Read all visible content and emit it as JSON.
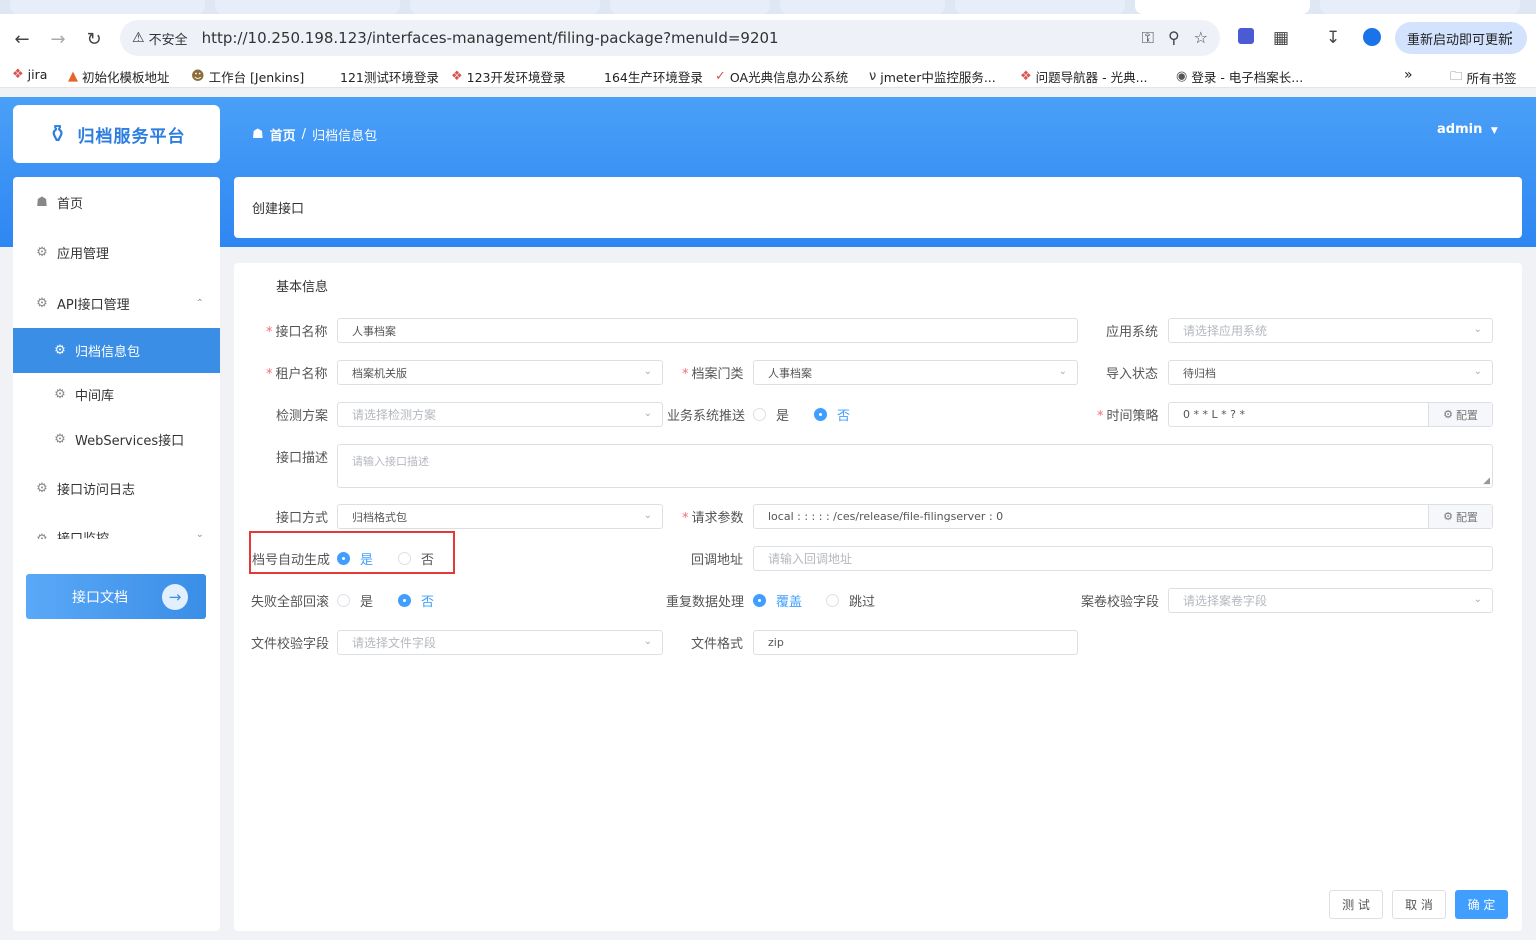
{
  "browser": {
    "security_label": "不安全",
    "url": "http://10.250.198.123/interfaces-management/filing-package?menuId=9201",
    "update_button": "重新启动即可更新",
    "bookmarks": [
      {
        "label": "jira"
      },
      {
        "label": "初始化模板地址"
      },
      {
        "label": "工作台 [Jenkins]"
      },
      {
        "label": "121测试环境登录"
      },
      {
        "label": "123开发环境登录"
      },
      {
        "label": "164生产环境登录"
      },
      {
        "label": "OA光典信息办公系统"
      },
      {
        "label": "jmeter中监控服务..."
      },
      {
        "label": "问题导航器 - 光典..."
      },
      {
        "label": "登录 - 电子档案长..."
      }
    ],
    "bookmarks_more": "»",
    "all_bookmarks": "所有书签"
  },
  "app": {
    "logo_text": "归档服务平台",
    "breadcrumb": {
      "home": "首页",
      "separator": "/",
      "current": "归档信息包"
    },
    "user": "admin"
  },
  "sidebar": {
    "items": [
      {
        "label": "首页",
        "icon": "home-icon"
      },
      {
        "label": "应用管理",
        "icon": "gear-icon"
      },
      {
        "label": "API接口管理",
        "icon": "gear-icon"
      },
      {
        "label": "归档信息包",
        "icon": "gear-icon"
      },
      {
        "label": "中间库",
        "icon": "gear-icon"
      },
      {
        "label": "WebServices接口",
        "icon": "gear-icon"
      },
      {
        "label": "接口访问日志",
        "icon": "gear-icon"
      },
      {
        "label": "接口监控",
        "icon": "gear-icon"
      }
    ],
    "doc_button": "接口文档"
  },
  "page": {
    "title": "创建接口",
    "section": "基本信息"
  },
  "form": {
    "interface_name": {
      "label": "接口名称",
      "value": "人事档案"
    },
    "app_system": {
      "label": "应用系统",
      "placeholder": "请选择应用系统"
    },
    "tenant_name": {
      "label": "租户名称",
      "value": "档案机关版"
    },
    "archive_category": {
      "label": "档案门类",
      "value": "人事档案"
    },
    "import_status": {
      "label": "导入状态",
      "value": "待归档"
    },
    "detect_plan": {
      "label": "检测方案",
      "placeholder": "请选择检测方案"
    },
    "biz_push": {
      "label": "业务系统推送",
      "yes": "是",
      "no": "否"
    },
    "time_strategy": {
      "label": "时间策略",
      "value": "0 * * L * ? *",
      "config": "配置"
    },
    "description": {
      "label": "接口描述",
      "placeholder": "请输入接口描述"
    },
    "interface_mode": {
      "label": "接口方式",
      "value": "归档格式包"
    },
    "request_params": {
      "label": "请求参数",
      "value": "local : : : : : /ces/release/file-filingserver : 0",
      "config": "配置"
    },
    "auto_archive_no": {
      "label": "档号自动生成",
      "yes": "是",
      "no": "否"
    },
    "callback_url": {
      "label": "回调地址",
      "placeholder": "请输入回调地址"
    },
    "rollback_all": {
      "label": "失败全部回滚",
      "yes": "是",
      "no": "否"
    },
    "duplicate_handling": {
      "label": "重复数据处理",
      "overwrite": "覆盖",
      "skip": "跳过"
    },
    "volume_check_field": {
      "label": "案卷校验字段",
      "placeholder": "请选择案卷字段"
    },
    "file_check_field": {
      "label": "文件校验字段",
      "placeholder": "请选择文件字段"
    },
    "file_format": {
      "label": "文件格式",
      "value": "zip"
    }
  },
  "actions": {
    "test": "测 试",
    "cancel": "取 消",
    "confirm": "确 定"
  }
}
